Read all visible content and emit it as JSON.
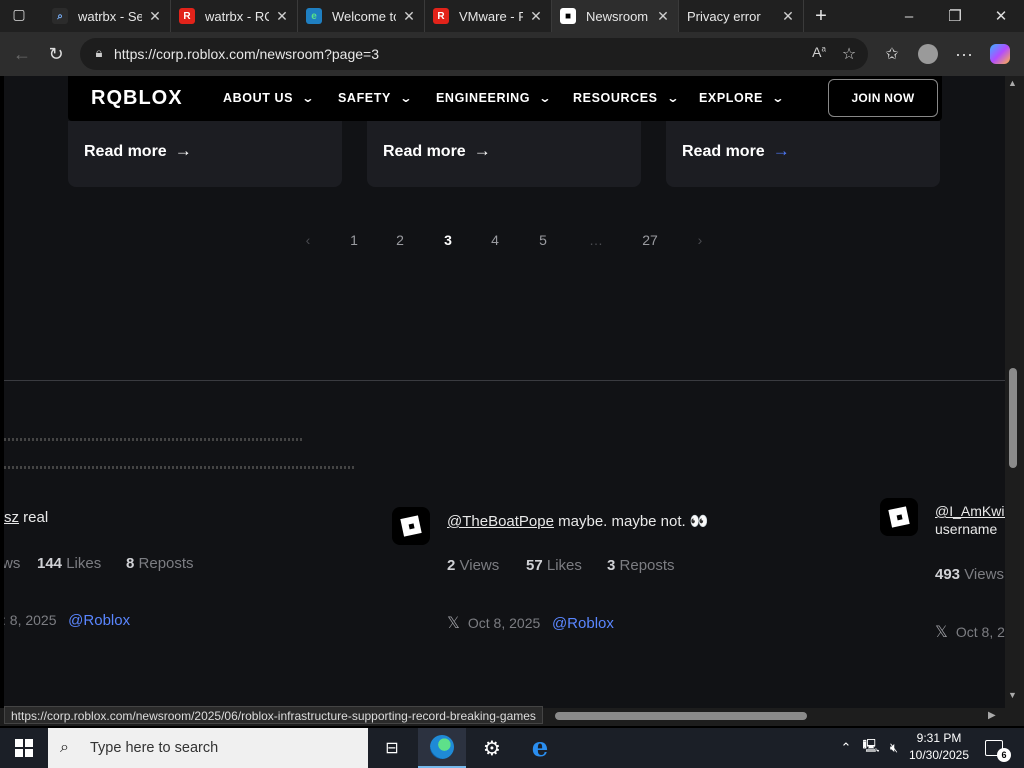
{
  "tabs": [
    {
      "title": "watrbx - Sea",
      "fav": "search",
      "fav_bg": "#2b2b2b",
      "fav_fg": "#7ab3ff",
      "fav_char": "⌕"
    },
    {
      "title": "watrbx - ROB",
      "fav": "roblox",
      "fav_bg": "#e2231a",
      "fav_fg": "#fff",
      "fav_char": "R"
    },
    {
      "title": "Welcome to",
      "fav": "edge",
      "fav_bg": "#1f7fc1",
      "fav_fg": "#57e38a",
      "fav_char": "e"
    },
    {
      "title": "VMware - Ro",
      "fav": "roblox",
      "fav_bg": "#e2231a",
      "fav_fg": "#fff",
      "fav_char": "R"
    },
    {
      "title": "Newsroom |",
      "fav": "roblox-newsroom",
      "fav_bg": "#fff",
      "fav_fg": "#000",
      "fav_char": "■"
    },
    {
      "title": "Privacy error",
      "fav": "none",
      "fav_bg": "transparent",
      "fav_fg": "#fff",
      "fav_char": ""
    }
  ],
  "address": {
    "url": "https://corp.roblox.com/newsroom?page=3"
  },
  "nav": {
    "logo": "RQBLOX",
    "items": [
      "ABOUT US",
      "SAFETY",
      "ENGINEERING",
      "RESOURCES",
      "EXPLORE"
    ],
    "join": "JOIN NOW"
  },
  "cards": [
    {
      "label": "Read more"
    },
    {
      "label": "Read more"
    },
    {
      "label": "Read more"
    }
  ],
  "pagination": {
    "prev": "‹",
    "pages": [
      "1",
      "2",
      "3",
      "4",
      "5"
    ],
    "current": "3",
    "ellipsis": "…",
    "last": "27",
    "next": "›"
  },
  "posts": [
    {
      "text_prefix": "sz",
      "text_rest": " real",
      "views_suffix": "ws",
      "likes": "144",
      "likes_label": "Likes",
      "reposts": "8",
      "reposts_label": "Reposts",
      "date": ": 8, 2025",
      "handle": "@Roblox"
    },
    {
      "mention": "@TheBoatPope",
      "text_rest": " maybe. maybe not. 👀",
      "views": "2",
      "views_label": "Views",
      "likes": "57",
      "likes_label": "Likes",
      "reposts": "3",
      "reposts_label": "Reposts",
      "date": "Oct 8, 2025",
      "handle": "@Roblox"
    },
    {
      "mention": "@I_AmKwis",
      "line2": "usernamе",
      "views": "493",
      "views_label": "Viewѕ",
      "date": "Oct 8, 2"
    }
  ],
  "status_url": "https://corp.roblox.com/newsroom/2025/06/roblox-infrastructure-supporting-record-breaking-games",
  "taskbar": {
    "search_placeholder": "Type here to search",
    "time": "9:31 PM",
    "date": "10/30/2025",
    "notifications": "6"
  }
}
